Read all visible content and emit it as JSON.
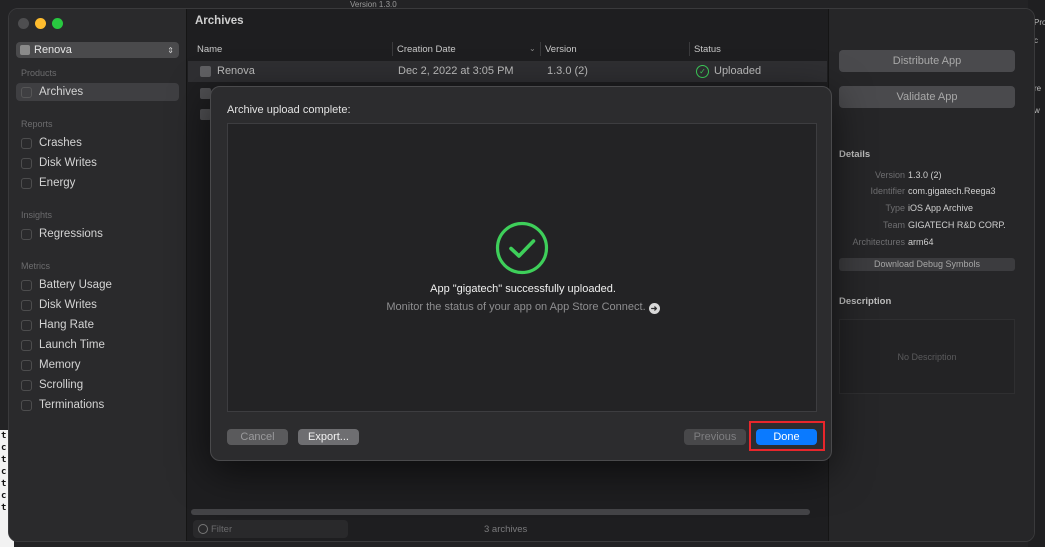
{
  "background": {
    "top_text": "Version   1.3.0",
    "left_strip": [
      "t",
      "c",
      "t",
      "c",
      "t",
      "c",
      "t"
    ],
    "right_strip": [
      "Pro",
      "c",
      "re",
      "w"
    ]
  },
  "sidebar": {
    "app_name": "Renova",
    "products_header": "Products",
    "archives": "Archives",
    "reports_header": "Reports",
    "reports": [
      "Crashes",
      "Disk Writes",
      "Energy"
    ],
    "insights_header": "Insights",
    "insights": [
      "Regressions"
    ],
    "metrics_header": "Metrics",
    "metrics": [
      "Battery Usage",
      "Disk Writes",
      "Hang Rate",
      "Launch Time",
      "Memory",
      "Scrolling",
      "Terminations"
    ]
  },
  "main": {
    "title": "Archives",
    "columns": {
      "name": "Name",
      "date": "Creation Date",
      "version": "Version",
      "status": "Status"
    },
    "row": {
      "name": "Renova",
      "date": "Dec 2, 2022 at 3:05 PM",
      "version": "1.3.0 (2)",
      "status": "Uploaded"
    },
    "filter_placeholder": "Filter",
    "count": "3 archives"
  },
  "inspector": {
    "distribute": "Distribute App",
    "validate": "Validate App",
    "details_header": "Details",
    "details": [
      {
        "k": "Version",
        "v": "1.3.0 (2)"
      },
      {
        "k": "Identifier",
        "v": "com.gigatech.Reega3"
      },
      {
        "k": "Type",
        "v": "iOS App Archive"
      },
      {
        "k": "Team",
        "v": "GIGATECH R&D CORP."
      },
      {
        "k": "Architectures",
        "v": "arm64"
      }
    ],
    "download_symbols": "Download Debug Symbols",
    "description_header": "Description",
    "no_description": "No Description"
  },
  "dialog": {
    "title": "Archive upload complete:",
    "message": "App \"gigatech\" successfully uploaded.",
    "sub_message": "Monitor the status of your app on App Store Connect.",
    "cancel": "Cancel",
    "export": "Export...",
    "previous": "Previous",
    "done": "Done"
  },
  "colors": {
    "success": "#3ecf5a",
    "accent": "#0a7aff",
    "highlight": "#e8262b"
  }
}
